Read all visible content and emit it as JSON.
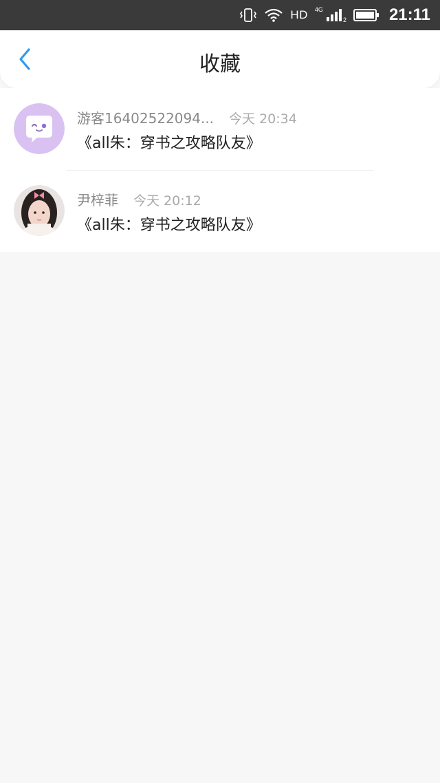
{
  "status_bar": {
    "hd_label": "HD",
    "network_label": "4G",
    "network_sub": "2",
    "time": "21:11",
    "icons": [
      "vibrate-icon",
      "wifi-icon",
      "signal-icon",
      "battery-icon"
    ]
  },
  "header": {
    "title": "收藏",
    "back_icon": "chevron-left-icon",
    "accent_color": "#2b9af3"
  },
  "favorites": [
    {
      "author": "游客16402522094...",
      "timestamp": "今天 20:34",
      "book_title": "《all朱：穿书之攻略队友》",
      "avatar": "default-chat-bubble-avatar",
      "avatar_color": "#d9c2f2"
    },
    {
      "author": "尹梓菲",
      "timestamp": "今天 20:12",
      "book_title": "《all朱：穿书之攻略队友》",
      "avatar": "user-photo-avatar"
    }
  ]
}
